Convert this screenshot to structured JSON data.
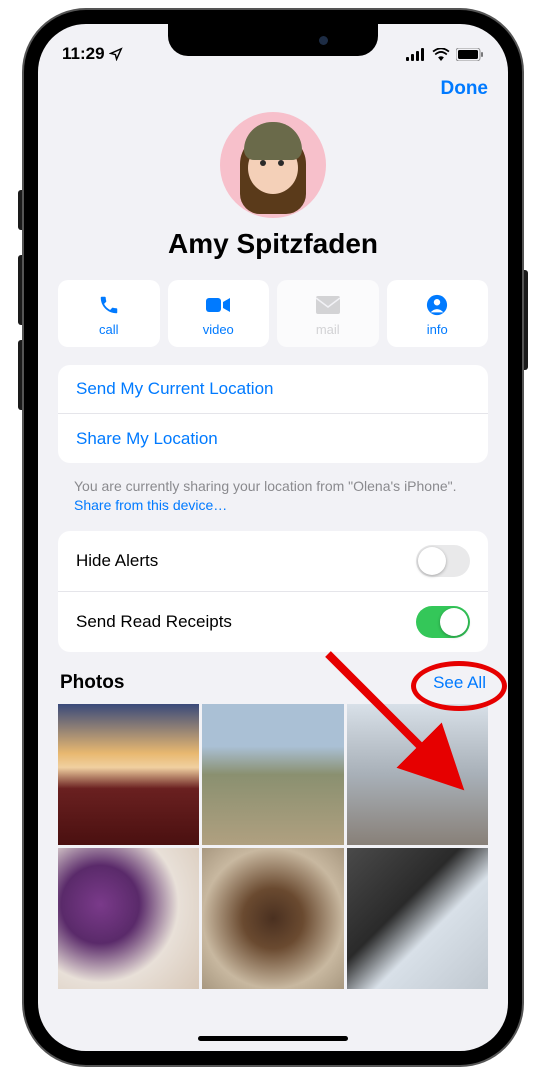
{
  "status": {
    "time": "11:29",
    "location_icon": "location-arrow"
  },
  "nav": {
    "done": "Done"
  },
  "contact": {
    "name": "Amy Spitzfaden"
  },
  "actions": [
    {
      "id": "call",
      "label": "call",
      "icon": "phone",
      "enabled": true
    },
    {
      "id": "video",
      "label": "video",
      "icon": "video",
      "enabled": true
    },
    {
      "id": "mail",
      "label": "mail",
      "icon": "envelope",
      "enabled": false
    },
    {
      "id": "info",
      "label": "info",
      "icon": "person",
      "enabled": true
    }
  ],
  "location_actions": {
    "send_current": "Send My Current Location",
    "share": "Share My Location"
  },
  "location_footer": {
    "prefix": "You are currently sharing your location from \"Olena's iPhone\". ",
    "link": "Share from this device…"
  },
  "settings": {
    "hide_alerts": {
      "label": "Hide Alerts",
      "on": false
    },
    "read_receipts": {
      "label": "Send Read Receipts",
      "on": true
    }
  },
  "photos": {
    "title": "Photos",
    "see_all": "See All"
  }
}
